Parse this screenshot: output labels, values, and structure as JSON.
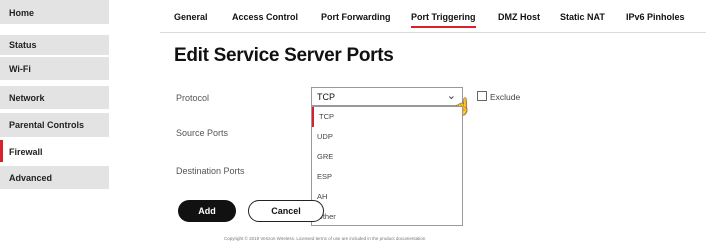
{
  "sidebar": {
    "items": [
      {
        "label": "Home"
      },
      {
        "label": "Status"
      },
      {
        "label": "Wi-Fi"
      },
      {
        "label": "Network"
      },
      {
        "label": "Parental Controls"
      },
      {
        "label": "Firewall",
        "active": true
      },
      {
        "label": "Advanced"
      }
    ]
  },
  "tabs": [
    {
      "label": "General"
    },
    {
      "label": "Access Control"
    },
    {
      "label": "Port Forwarding"
    },
    {
      "label": "Port Triggering",
      "active": true
    },
    {
      "label": "DMZ Host"
    },
    {
      "label": "Static NAT"
    },
    {
      "label": "IPv6 Pinholes"
    }
  ],
  "page": {
    "title": "Edit Service Server Ports"
  },
  "form": {
    "protocol_label": "Protocol",
    "source_ports_label": "Source Ports",
    "destination_ports_label": "Destination Ports",
    "protocol_value": "TCP",
    "exclude_label": "Exclude",
    "protocol_options": [
      "TCP",
      "UDP",
      "GRE",
      "ESP",
      "AH",
      "Other"
    ]
  },
  "buttons": {
    "add": "Add",
    "cancel": "Cancel"
  },
  "footer": {
    "text": "Copyright © 2019 Verizon Wireless. Licensed terms of use are included in the product documentation"
  },
  "colors": {
    "accent": "#d9212b",
    "sidebar_bg": "#e3e3e3"
  }
}
